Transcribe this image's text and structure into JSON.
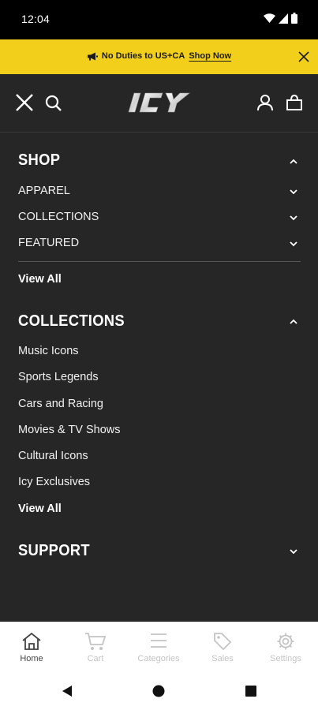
{
  "status_bar": {
    "time": "12:04"
  },
  "promo": {
    "text": "No Duties to US+CA",
    "link_text": "Shop Now"
  },
  "header": {
    "logo_text": "ICY"
  },
  "menu": {
    "shop": {
      "title": "SHOP",
      "items": [
        {
          "label": "APPAREL"
        },
        {
          "label": "COLLECTIONS"
        },
        {
          "label": "FEATURED"
        }
      ],
      "view_all": "View All"
    },
    "collections": {
      "title": "COLLECTIONS",
      "items": [
        {
          "label": "Music Icons"
        },
        {
          "label": "Sports Legends"
        },
        {
          "label": "Cars and Racing"
        },
        {
          "label": "Movies & TV Shows"
        },
        {
          "label": "Cultural Icons"
        },
        {
          "label": "Icy Exclusives"
        }
      ],
      "view_all": "View All"
    },
    "support": {
      "title": "SUPPORT"
    }
  },
  "bottom_nav": {
    "items": [
      {
        "label": "Home",
        "icon": "home-icon",
        "active": true
      },
      {
        "label": "Cart",
        "icon": "cart-icon"
      },
      {
        "label": "Categories",
        "icon": "categories-icon"
      },
      {
        "label": "Sales",
        "icon": "tag-icon"
      },
      {
        "label": "Settings",
        "icon": "gear-icon"
      }
    ]
  },
  "colors": {
    "banner": "#f2cf1a",
    "menu_bg": "#262626",
    "status_bg": "#000000"
  }
}
